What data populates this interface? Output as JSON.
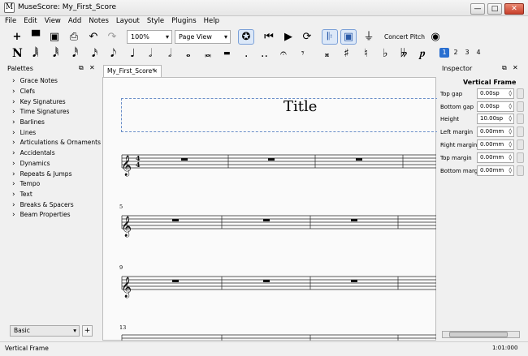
{
  "window": {
    "title": "MuseScore: My_First_Score",
    "app_icon": "musescore-logo",
    "minimize": "—",
    "maximize": "□",
    "close": "✕"
  },
  "menu": [
    "File",
    "Edit",
    "View",
    "Add",
    "Notes",
    "Layout",
    "Style",
    "Plugins",
    "Help"
  ],
  "toolbar": {
    "zoom": "100%",
    "view_mode": "Page View",
    "concert_pitch": "Concert Pitch",
    "icons": {
      "new": "+",
      "open": "▀",
      "save": "▣",
      "print": "⎙",
      "undo": "↶",
      "redo": "↷",
      "midi": "✪",
      "rewind": "⏮",
      "play": "▶",
      "loop": "⟳",
      "repeat": "𝄆",
      "pan": "▣",
      "metronome": "⏚",
      "image_capture": "◉"
    }
  },
  "note_input": {
    "icons": {
      "note_input": "N",
      "durations": [
        "𝅘𝅥𝅲",
        "𝅘𝅥𝅱",
        "𝅘𝅥𝅰",
        "𝅘𝅥𝅯",
        "𝅘𝅥𝅮",
        "♩",
        "𝅗𝅥",
        "𝅝",
        "𝅜",
        "▬",
        ".",
        "..",
        "𝄐",
        "𝄾",
        "𝄪",
        "♯",
        "♮",
        "♭",
        "𝄫",
        "𝆏"
      ]
    },
    "voices": [
      "1",
      "2",
      "3",
      "4"
    ]
  },
  "palettes": {
    "title": "Palettes",
    "items": [
      "Grace Notes",
      "Clefs",
      "Key Signatures",
      "Time Signatures",
      "Barlines",
      "Lines",
      "Articulations & Ornaments",
      "Accidentals",
      "Dynamics",
      "Repeats & Jumps",
      "Tempo",
      "Text",
      "Breaks & Spacers",
      "Beam Properties"
    ],
    "workspace": "Basic",
    "add": "+"
  },
  "score": {
    "tab": "My_First_Score*",
    "title": "Title",
    "measure_numbers": [
      "5",
      "9",
      "13"
    ]
  },
  "inspector": {
    "title": "Inspector",
    "section": "Vertical Frame",
    "fields": [
      {
        "label": "Top gap",
        "value": "0.00sp"
      },
      {
        "label": "Bottom gap",
        "value": "0.00sp"
      },
      {
        "label": "Height",
        "value": "10.00sp"
      },
      {
        "label": "Left margin",
        "value": "0.00mm"
      },
      {
        "label": "Right margin",
        "value": "0.00mm"
      },
      {
        "label": "Top margin",
        "value": "0.00mm"
      },
      {
        "label": "Bottom margin",
        "value": "0.00mm"
      }
    ]
  },
  "status": {
    "left": "Vertical Frame",
    "right": "1:01:000"
  }
}
